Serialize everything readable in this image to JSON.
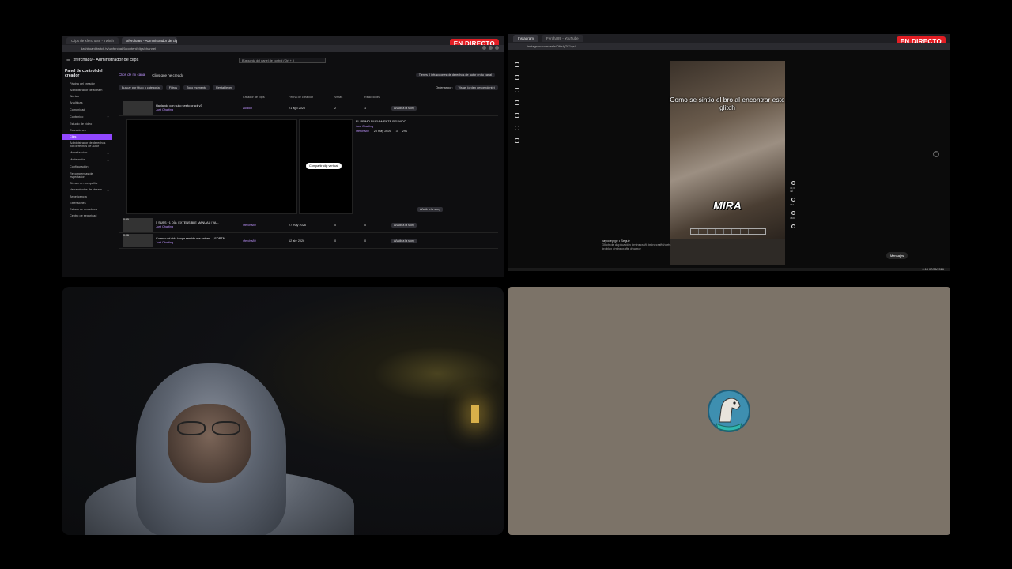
{
  "live_badge": "EN DIRECTO",
  "twitch": {
    "tabs": [
      "Clips de xfercha89 - Twitch",
      "xfercha89 - Administrador de clips"
    ],
    "url": "dashboard.twitch.tv/u/xfercha89/content/clips/channel",
    "page_title": "xfercha89 - Administrador de clips",
    "search_placeholder": "Búsqueda del panel de control (Ctrl + /)",
    "sidebar": {
      "header": "Panel de control del creador",
      "items": [
        {
          "label": "Página del creador",
          "caret": ""
        },
        {
          "label": "Administrador de stream",
          "caret": ""
        },
        {
          "label": "Alertas",
          "caret": ""
        },
        {
          "label": "Analíticas",
          "caret": "⌄"
        },
        {
          "label": "Comunidad",
          "caret": "⌄"
        },
        {
          "label": "Contenido",
          "caret": "⌃"
        },
        {
          "label": "Estudio de vídeo",
          "caret": ""
        },
        {
          "label": "Colecciones",
          "caret": ""
        },
        {
          "label": "Clips",
          "caret": ""
        },
        {
          "label": "Administrador de derechos por derechos de autor",
          "caret": ""
        },
        {
          "label": "Monetización",
          "caret": "⌄"
        },
        {
          "label": "Moderación",
          "caret": "⌄"
        },
        {
          "label": "Configuración",
          "caret": "⌄"
        },
        {
          "label": "Recompensas de espectador",
          "caret": "⌄"
        },
        {
          "label": "Stream en compañía",
          "caret": ""
        },
        {
          "label": "Herramientas de stream",
          "caret": "⌄"
        },
        {
          "label": "Beneficencia",
          "caret": ""
        },
        {
          "label": "Extensiones",
          "caret": ""
        },
        {
          "label": "Estado de creadores",
          "caret": ""
        },
        {
          "label": "Centro de seguridad",
          "caret": ""
        }
      ],
      "selected": "Clips"
    },
    "tabs_row": {
      "channel": "Clips de mi canal",
      "created": "Clips que he creado"
    },
    "notice": "Tienes 0 infracciones de derechos de autor en tu canal",
    "filters": {
      "search": "Buscar por título o categoría",
      "filter": "Filtros",
      "time": "Todo momento",
      "reset": "Restablecer"
    },
    "sort": {
      "label": "Ordenar por:",
      "value": "Vistas (orden descendente)"
    },
    "columns": {
      "creator": "Creador de clips",
      "date": "Fecha de creación",
      "views": "Vistas",
      "reactions": "Reacciones"
    },
    "rows": [
      {
        "title": "Hablando con suko sesito crack v3",
        "category": "Just Chatting",
        "creator": "zulaloh",
        "date": "21 ago 2020",
        "views": "2",
        "reactions": "1",
        "share": "Añadir a la story"
      },
      {
        "title": "5 SUBS +1 DÍA: EXTENSIBLE MANUAL | VA...",
        "category": "Just Chatting",
        "creator": "xfercha89",
        "date": "27 may 2026",
        "views": "0",
        "reactions": "0",
        "share": "Añadir a la story"
      },
      {
        "title": "Cuando mi vida tenga sentido me extran... | FORTN...",
        "category": "Just Chatting",
        "creator": "xfercha89",
        "date": "12 abr 2026",
        "views": "0",
        "reactions": "0",
        "share": "Añadir a la story"
      }
    ],
    "expanded": {
      "title": "EL PRIMO NUEVAMENTE REUNIDO",
      "category": "Just Chatting",
      "creator": "xfercha89",
      "date": "25 may 2026",
      "views": "3",
      "duration": "29s",
      "vertical_button": "Compartir clip vertical",
      "share": "Añadir a la story"
    },
    "thumb_times": [
      "0:30",
      "0:29"
    ]
  },
  "instagram": {
    "tabs": [
      "Instagram",
      "Fercha89 - YouTube"
    ],
    "url": "instagram.com/reels/DKzIy7C1qe/",
    "caption_top": "Como se sintio el bro al encontrar este glitch",
    "caption_bottom": "MIRA",
    "user": "vayodeyrge • Seguir",
    "description": "Glitch de duplicación #minecraft #minecraftshorts #roblox #minecrafte #humor",
    "likes": "40,3 mil",
    "comments": "221",
    "shares": "4600",
    "messages": "Mensajes"
  },
  "taskbar": {
    "time": "0:18",
    "date": "07/06/2026"
  }
}
